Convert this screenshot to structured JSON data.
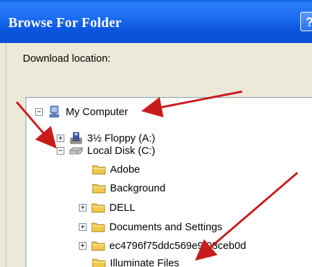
{
  "window": {
    "title": "Browse For Folder",
    "help_button": "?"
  },
  "dialog": {
    "prompt": "Download location:"
  },
  "tree": {
    "my_computer": "My Computer",
    "floppy": "3½ Floppy (A:)",
    "local_disk": "Local Disk (C:)",
    "folders": {
      "adobe": "Adobe",
      "background": "Background",
      "dell": "DELL",
      "documents": "Documents and Settings",
      "hash": "ec4796f75ddc569e9f03ceb0d",
      "illuminate": "Illuminate Files"
    },
    "expander_collapsed": "+",
    "expander_expanded": "−"
  },
  "colors": {
    "title_bar": "#0b58e0",
    "dialog_bg": "#ece9d8",
    "tree_border": "#7f9db9",
    "folder": "#f2c94c",
    "annotation_arrow": "#c81c1c"
  },
  "icons": {
    "my_computer": "computer-icon",
    "floppy": "floppy-drive-icon",
    "local_disk": "hard-disk-icon",
    "folder": "folder-icon",
    "annotation": "red-arrow-icon"
  }
}
